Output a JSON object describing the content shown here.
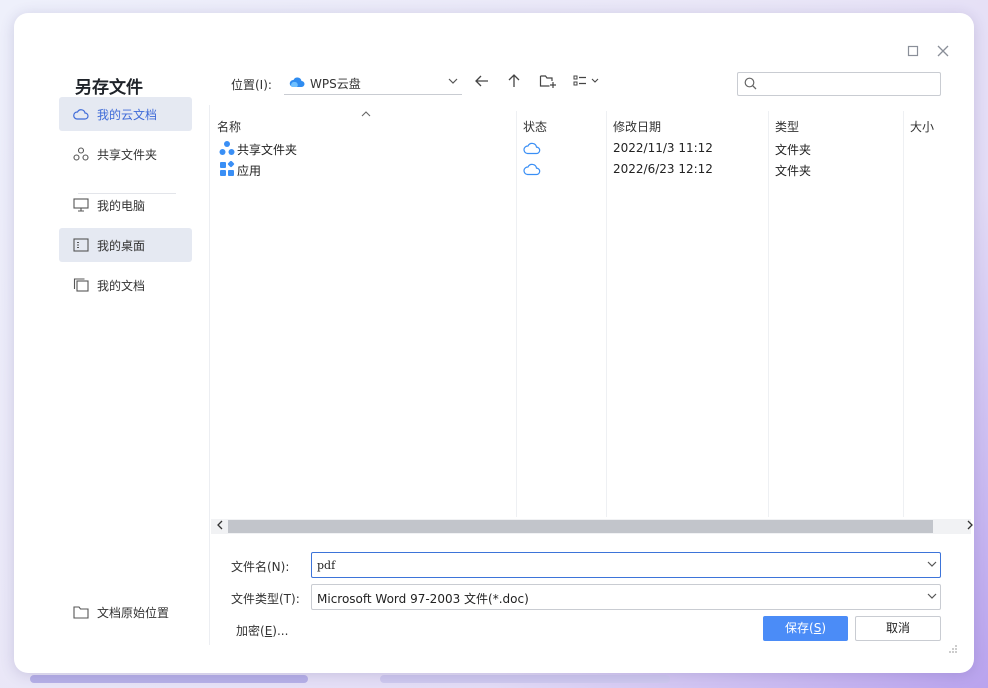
{
  "dialog": {
    "title": "另存文件"
  },
  "location": {
    "label": "位置(I):",
    "value": "WPS云盘"
  },
  "search": {
    "placeholder": "",
    "value": ""
  },
  "sidebar": {
    "items": [
      {
        "label": "我的云文档",
        "icon": "cloud-icon",
        "active": true
      },
      {
        "label": "共享文件夹",
        "icon": "share-icon",
        "active": false
      },
      {
        "label": "我的电脑",
        "icon": "monitor-icon",
        "active": false
      },
      {
        "label": "我的桌面",
        "icon": "desktop-icon",
        "active": true
      },
      {
        "label": "我的文档",
        "icon": "documents-icon",
        "active": false
      }
    ],
    "bottom": {
      "label": "文档原始位置",
      "icon": "folder-icon"
    }
  },
  "table": {
    "columns": [
      "名称",
      "状态",
      "修改日期",
      "类型",
      "大小"
    ],
    "rows": [
      {
        "name": "共享文件夹",
        "icon": "shared-folder-icon",
        "status": "cloud-icon",
        "modified": "2022/11/3 11:12",
        "type": "文件夹",
        "size": ""
      },
      {
        "name": "应用",
        "icon": "apps-icon",
        "status": "cloud-icon",
        "modified": "2022/6/23 12:12",
        "type": "文件夹",
        "size": ""
      }
    ]
  },
  "form": {
    "filename_label": "文件名(N):",
    "filename_value": "pdf",
    "filetype_label": "文件类型(T):",
    "filetype_value": "Microsoft Word 97-2003 文件(*.doc)",
    "encrypt_prefix": "加密(",
    "encrypt_key": "E",
    "encrypt_suffix": ")...",
    "save_prefix": "保存(",
    "save_key": "S",
    "save_suffix": ")",
    "cancel_label": "取消"
  },
  "colors": {
    "accent": "#4b8cf7",
    "cloud_blue": "#3f6bd8",
    "active_bg": "#e5e9f2"
  }
}
